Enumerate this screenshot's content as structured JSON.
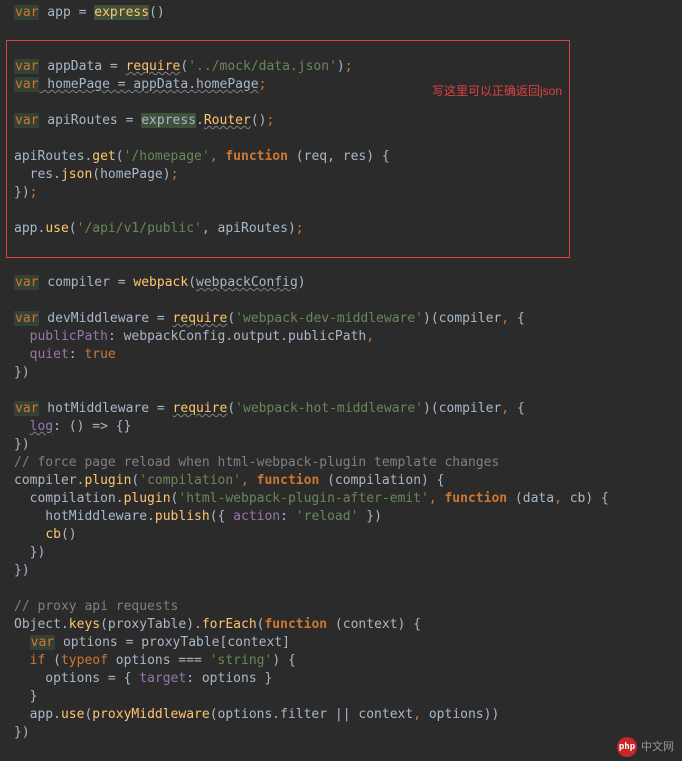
{
  "annotation": "写这里可以正确返回json",
  "logo_text": "中文网",
  "logo_badge": "php",
  "code": {
    "l1_var": "var",
    "l1_rest": " app = ",
    "l1_express": "express",
    "l1_paren": "()",
    "l4_var": "var",
    "l4_ident": " appData = ",
    "l4_req": "require",
    "l4_paren1": "(",
    "l4_str": "'../mock/data.json'",
    "l4_paren2": ")",
    "l4_semi": ";",
    "l5_var": "var",
    "l5_rest": " homePage = appData.homePage",
    "l5_semi": ";",
    "l7_var": "var",
    "l7_ident": " apiRoutes = ",
    "l7_express": "express",
    "l7_dot": ".",
    "l7_router": "Router",
    "l7_paren": "()",
    "l7_semi": ";",
    "l9_a": "apiRoutes.",
    "l9_get": "get",
    "l9_p1": "(",
    "l9_str": "'/homepage'",
    "l9_comma": ", ",
    "l9_func": "function",
    "l9_args": " (req, res) {",
    "l10_ind": "  res.",
    "l10_json": "json",
    "l10_p": "(homePage)",
    "l10_semi": ";",
    "l11": "})",
    "l11_semi": ";",
    "l13_a": "app.",
    "l13_use": "use",
    "l13_p1": "(",
    "l13_str": "'/api/v1/public'",
    "l13_rest": ", apiRoutes)",
    "l13_semi": ";",
    "l16_var": "var",
    "l16_a": " compiler = ",
    "l16_wb": "webpack",
    "l16_p1": "(",
    "l16_wc": "webpackConfig",
    "l16_p2": ")",
    "l18_var": "var",
    "l18_a": " devMiddleware = ",
    "l18_req": "require",
    "l18_p1": "(",
    "l18_str": "'webpack-dev-middleware'",
    "l18_p2": ")(compiler",
    "l18_comma": ",",
    "l18_brace": " {",
    "l19_ind": "  ",
    "l19_pp": "publicPath",
    "l19_colon": ": ",
    "l19_rest": "webpackConfig.output.publicPath",
    "l19_comma": ",",
    "l20_ind": "  ",
    "l20_q": "quiet",
    "l20_colon": ": ",
    "l20_true": "true",
    "l21": "})",
    "l23_var": "var",
    "l23_a": " hotMiddleware = ",
    "l23_req": "require",
    "l23_p1": "(",
    "l23_str": "'webpack-hot-middleware'",
    "l23_p2": ")(compiler",
    "l23_comma": ",",
    "l23_brace": " {",
    "l24_ind": "  ",
    "l24_log": "log",
    "l24_rest": ": () => {}",
    "l25": "})",
    "l26": "// force page reload when html-webpack-plugin template changes",
    "l27_a": "compiler.",
    "l27_plugin": "plugin",
    "l27_p1": "(",
    "l27_str": "'compilation'",
    "l27_comma": ", ",
    "l27_func": "function",
    "l27_args": " (compilation) {",
    "l28_ind": "  compilation.",
    "l28_plugin": "plugin",
    "l28_p1": "(",
    "l28_str": "'html-webpack-plugin-after-emit'",
    "l28_comma": ", ",
    "l28_func": "function",
    "l28_args": " (data",
    "l28_c2": ",",
    "l28_cb": " cb) {",
    "l29_ind": "    hotMiddleware.",
    "l29_pub": "publish",
    "l29_p1": "({ ",
    "l29_action": "action",
    "l29_colon": ": ",
    "l29_str": "'reload'",
    "l29_p2": " })",
    "l30_ind": "    ",
    "l30_cb": "cb",
    "l30_p": "()",
    "l31": "  })",
    "l32": "})",
    "l34": "// proxy api requests",
    "l35_a": "Object.",
    "l35_keys": "keys",
    "l35_p1": "(proxyTable).",
    "l35_fe": "forEach",
    "l35_p2": "(",
    "l35_func": "function",
    "l35_args": " (context) {",
    "l36_ind": "  ",
    "l36_var": "var",
    "l36_rest": " options = proxyTable[context]",
    "l37_ind": "  ",
    "l37_if": "if",
    "l37_p1": " (",
    "l37_typeof": "typeof",
    "l37_rest": " options === ",
    "l37_str": "'string'",
    "l37_p2": ") {",
    "l38_ind": "    options = { ",
    "l38_target": "target",
    "l38_rest": ": options }",
    "l39": "  }",
    "l40_ind": "  app.",
    "l40_use": "use",
    "l40_p1": "(",
    "l40_pm": "proxyMiddleware",
    "l40_p2": "(options.filter || context",
    "l40_comma": ",",
    "l40_rest": " options))",
    "l41": "})"
  }
}
